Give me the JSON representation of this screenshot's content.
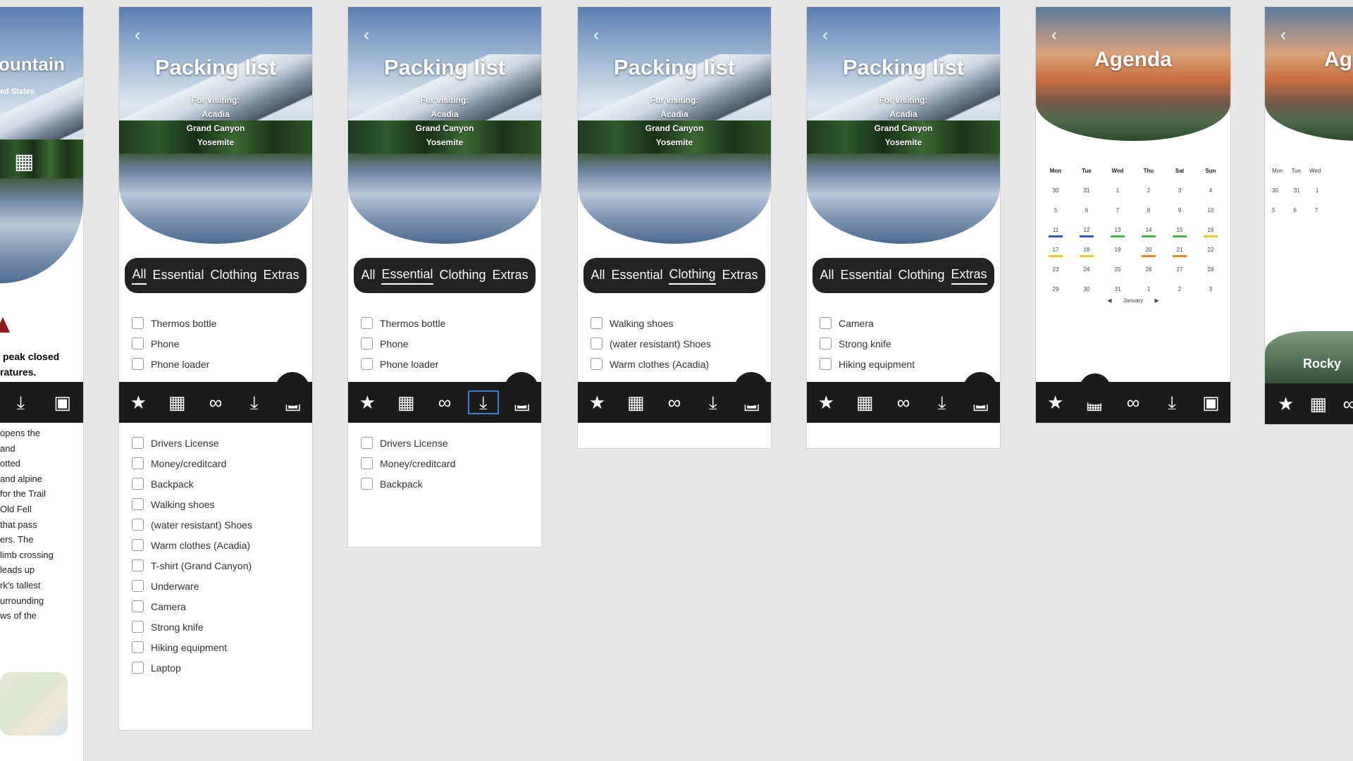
{
  "left_screen": {
    "title_partial": "ountain",
    "subtitle_partial": "ed States",
    "alert_line1": "peak closed",
    "alert_line2": "ratures.",
    "body_lines": [
      "opens the",
      "and",
      "otted",
      "and alpine",
      "for the Trail",
      "Old Fell",
      "that pass",
      "ers. The",
      "limb crossing",
      "leads up",
      "rk's tallest",
      "urrounding",
      "ws of the"
    ]
  },
  "packing": {
    "title": "Packing list",
    "subtitle": [
      "For visiting:",
      "Acadia",
      "Grand Canyon",
      "Yosemite"
    ],
    "filters": [
      "All",
      "Essential",
      "Clothing",
      "Extras"
    ]
  },
  "screens": [
    {
      "active_filter": 0,
      "items": [
        "Thermos bottle",
        "Phone",
        "Phone loader"
      ],
      "items_below": [
        "Drivers License",
        "Money/creditcard",
        "Backpack",
        "Walking shoes",
        "(water resistant) Shoes",
        "Warm clothes (Acadia)",
        "T-shirt (Grand Canyon)",
        "Underware",
        "Camera",
        "Strong knife",
        "Hiking equipment",
        "Laptop"
      ]
    },
    {
      "active_filter": 1,
      "items": [
        "Thermos bottle",
        "Phone",
        "Phone loader"
      ],
      "items_below": [
        "Drivers License",
        "Money/creditcard",
        "Backpack"
      ]
    },
    {
      "active_filter": 2,
      "items": [
        "Walking shoes",
        "(water resistant) Shoes",
        "Warm clothes (Acadia)"
      ],
      "items_below": []
    },
    {
      "active_filter": 3,
      "items": [
        "Camera",
        "Strong knife",
        "Hiking equipment"
      ],
      "items_below": []
    }
  ],
  "nav_icons": [
    "star-icon",
    "grid-icon",
    "binoculars-icon",
    "download-icon",
    "backpack-icon"
  ],
  "nav_glyphs": [
    "★",
    "▦",
    "∞",
    "⤓",
    "▣"
  ],
  "agenda": {
    "title": "Agenda",
    "days": [
      "Mon",
      "Tue",
      "Wed",
      "Thu",
      "Sat",
      "Sun"
    ],
    "rows": [
      [
        "30",
        "31",
        "1",
        "2",
        "3",
        "4"
      ],
      [
        "5",
        "6",
        "7",
        "8",
        "9",
        "10"
      ],
      [
        "11",
        "12",
        "13",
        "14",
        "15",
        "16"
      ],
      [
        "17",
        "18",
        "19",
        "20",
        "21",
        "22"
      ],
      [
        "23",
        "24",
        "25",
        "26",
        "27",
        "28"
      ],
      [
        "29",
        "30",
        "31",
        "1",
        "2",
        "3"
      ]
    ],
    "month": "January",
    "prev_glyph": "◀",
    "next_glyph": "▶"
  },
  "right_partial": {
    "title_partial": "Ag",
    "card_label_partial": "Rocky"
  },
  "colors": {
    "marker_blue": "#3c4ec9",
    "marker_green": "#46b24b",
    "marker_yellow": "#e6cf2a",
    "marker_orange": "#e48a25",
    "nav_bg": "#1b1b1b",
    "selection": "#3d7fd6"
  }
}
